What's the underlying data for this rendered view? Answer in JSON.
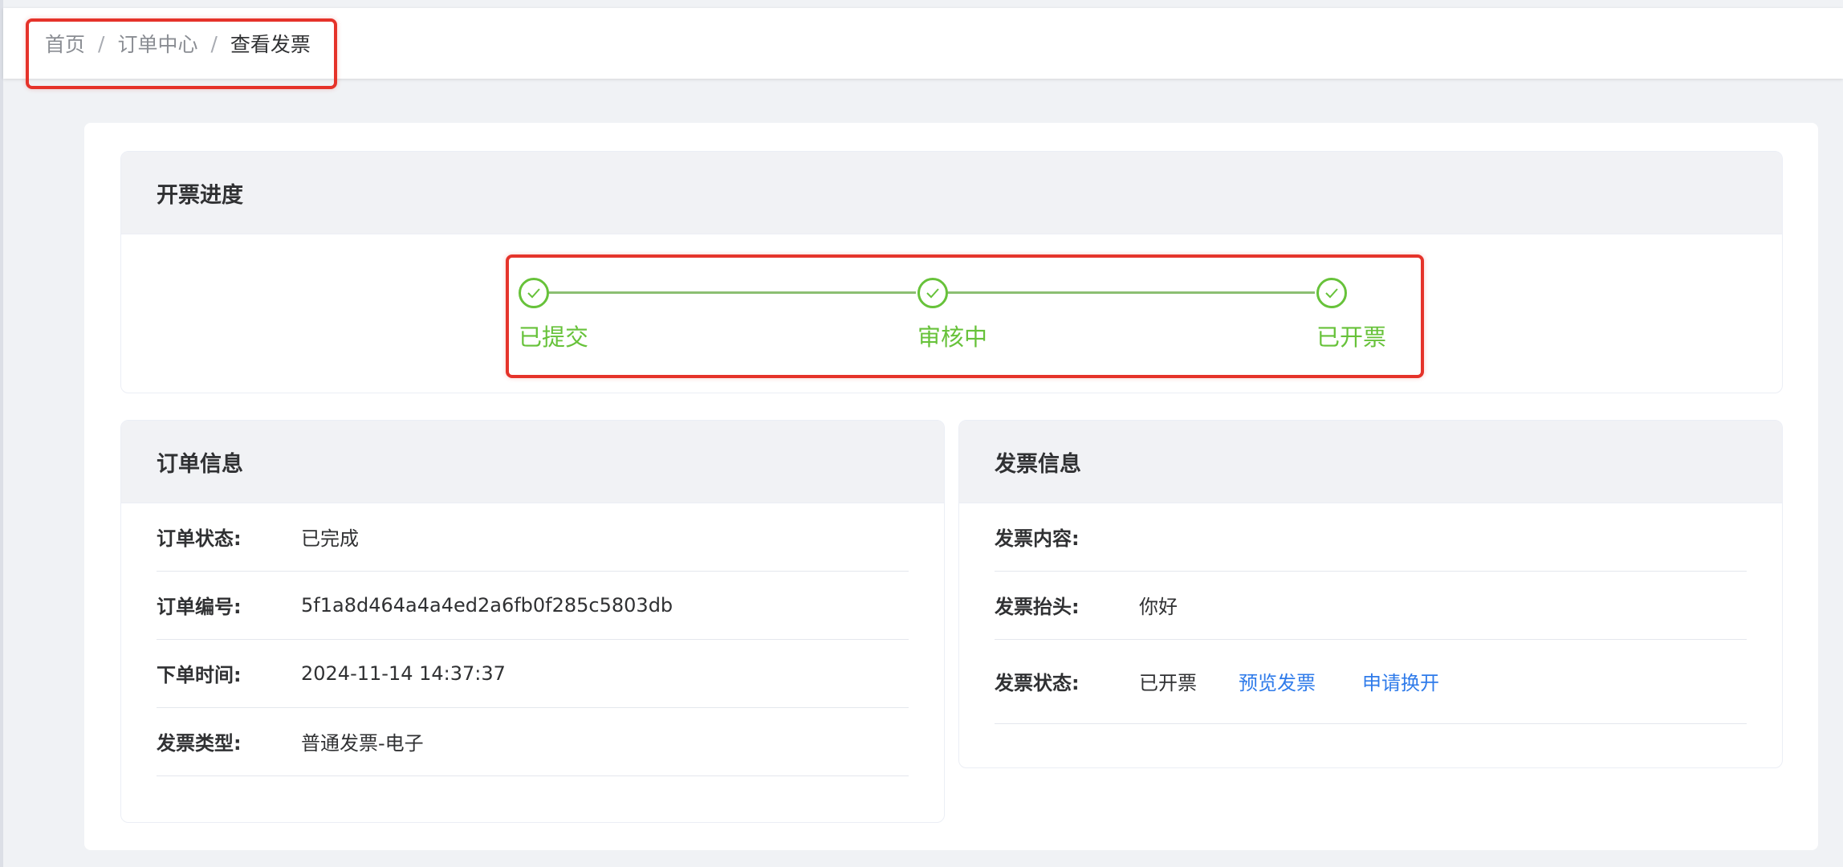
{
  "breadcrumb": {
    "items": [
      "首页",
      "订单中心"
    ],
    "current": "查看发票",
    "separator": "/"
  },
  "progress": {
    "title": "开票进度",
    "steps": [
      {
        "label": "已提交",
        "status": "done"
      },
      {
        "label": "审核中",
        "status": "done"
      },
      {
        "label": "已开票",
        "status": "done"
      }
    ],
    "color": "#67c23a"
  },
  "order_info": {
    "title": "订单信息",
    "rows": [
      {
        "label": "订单状态:",
        "value": "已完成"
      },
      {
        "label": "订单编号:",
        "value": "5f1a8d464a4a4ed2a6fb0f285c5803db"
      },
      {
        "label": "下单时间:",
        "value": "2024-11-14 14:37:37"
      },
      {
        "label": "发票类型:",
        "value": "普通发票-电子"
      }
    ]
  },
  "invoice_info": {
    "title": "发票信息",
    "content_label": "发票内容:",
    "content_value": "",
    "header_label": "发票抬头:",
    "header_value": "你好",
    "status_label": "发票状态:",
    "status_value": "已开票",
    "preview_link": "预览发票",
    "reissue_link": "申请换开"
  },
  "colors": {
    "accent_green": "#67c23a",
    "link_blue": "#2f7bea",
    "highlight_red": "#e5332a"
  }
}
